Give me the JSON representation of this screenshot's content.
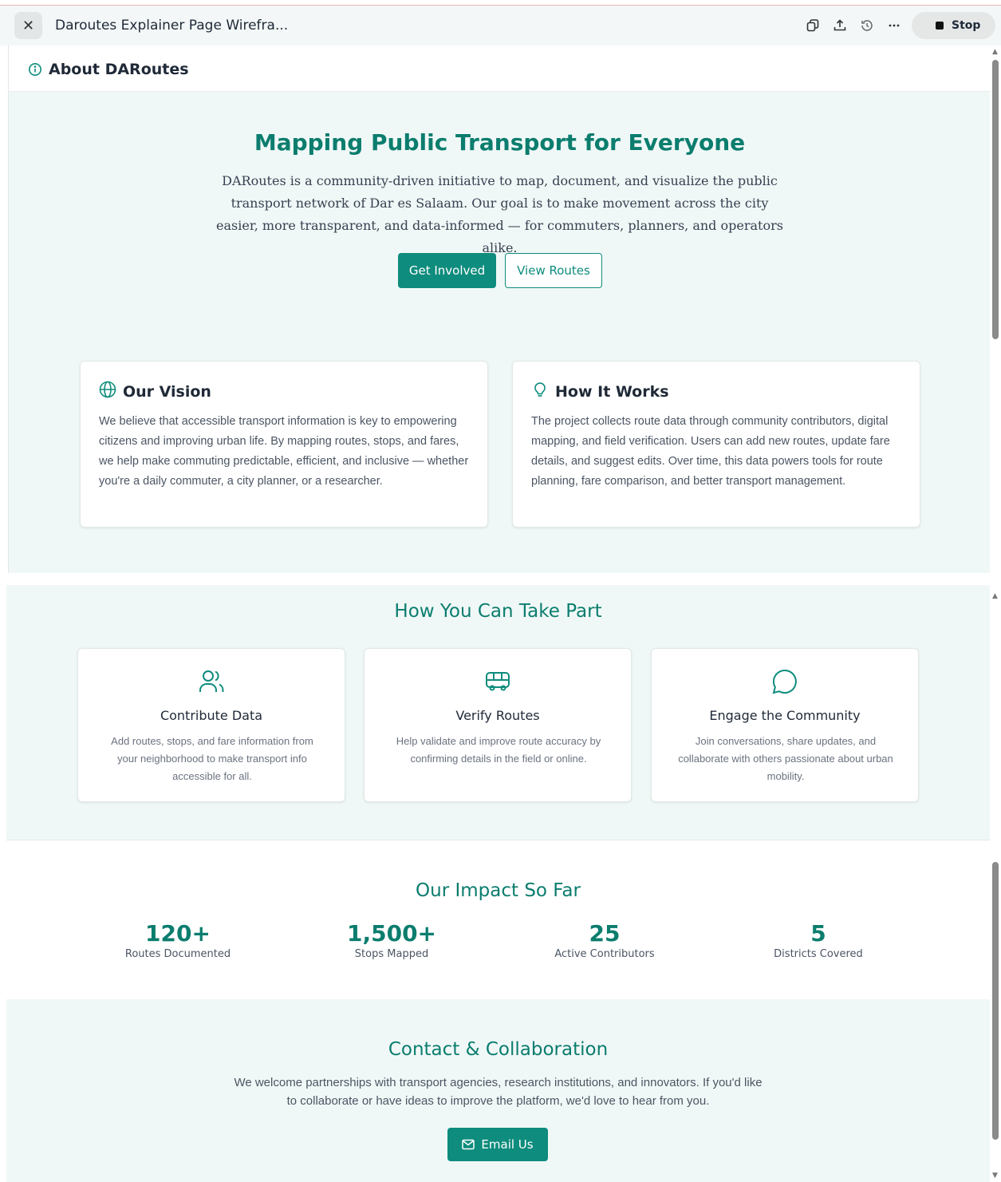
{
  "window": {
    "doc_title": "Daroutes Explainer Page Wirefra...",
    "stop_label": "Stop"
  },
  "header": {
    "title": "About DARoutes"
  },
  "hero": {
    "title": "Mapping Public Transport for Everyone",
    "description": "DARoutes is a community-driven initiative to map, document, and visualize the public transport network of Dar es Salaam. Our goal is to make movement across the city easier, more transparent, and data-informed — for commuters, planners, and operators alike.",
    "primary_button": "Get Involved",
    "secondary_button": "View Routes"
  },
  "cards": [
    {
      "title": "Our Vision",
      "icon": "globe-icon",
      "body": "We believe that accessible transport information is key to empowering citizens and improving urban life. By mapping routes, stops, and fares, we help make commuting predictable, efficient, and inclusive — whether you're a daily commuter, a city planner, or a researcher."
    },
    {
      "title": "How It Works",
      "icon": "lightbulb-icon",
      "body": "The project collects route data through community contributors, digital mapping, and field verification. Users can add new routes, update fare details, and suggest edits. Over time, this data powers tools for route planning, fare comparison, and better transport management."
    }
  ],
  "take_part": {
    "title": "How You Can Take Part",
    "items": [
      {
        "title": "Contribute Data",
        "icon": "users-icon",
        "desc": "Add routes, stops, and fare information from your neighborhood to make transport info accessible for all."
      },
      {
        "title": "Verify Routes",
        "icon": "bus-icon",
        "desc": "Help validate and improve route accuracy by confirming details in the field or online."
      },
      {
        "title": "Engage the Community",
        "icon": "chat-bubble-icon",
        "desc": "Join conversations, share updates, and collaborate with others passionate about urban mobility."
      }
    ]
  },
  "impact": {
    "title": "Our Impact So Far",
    "stats": [
      {
        "value": "120+",
        "label": "Routes Documented"
      },
      {
        "value": "1,500+",
        "label": "Stops Mapped"
      },
      {
        "value": "25",
        "label": "Active Contributors"
      },
      {
        "value": "5",
        "label": "Districts Covered"
      }
    ]
  },
  "contact": {
    "title": "Contact & Collaboration",
    "text": "We welcome partnerships with transport agencies, research institutions, and innovators. If you'd like to collaborate or have ideas to improve the platform, we'd love to hear from you.",
    "button": "Email Us"
  },
  "colors": {
    "accent": "#0e8c7d",
    "heading": "#0b7d6e",
    "panel_bg": "#f0f8f7"
  }
}
